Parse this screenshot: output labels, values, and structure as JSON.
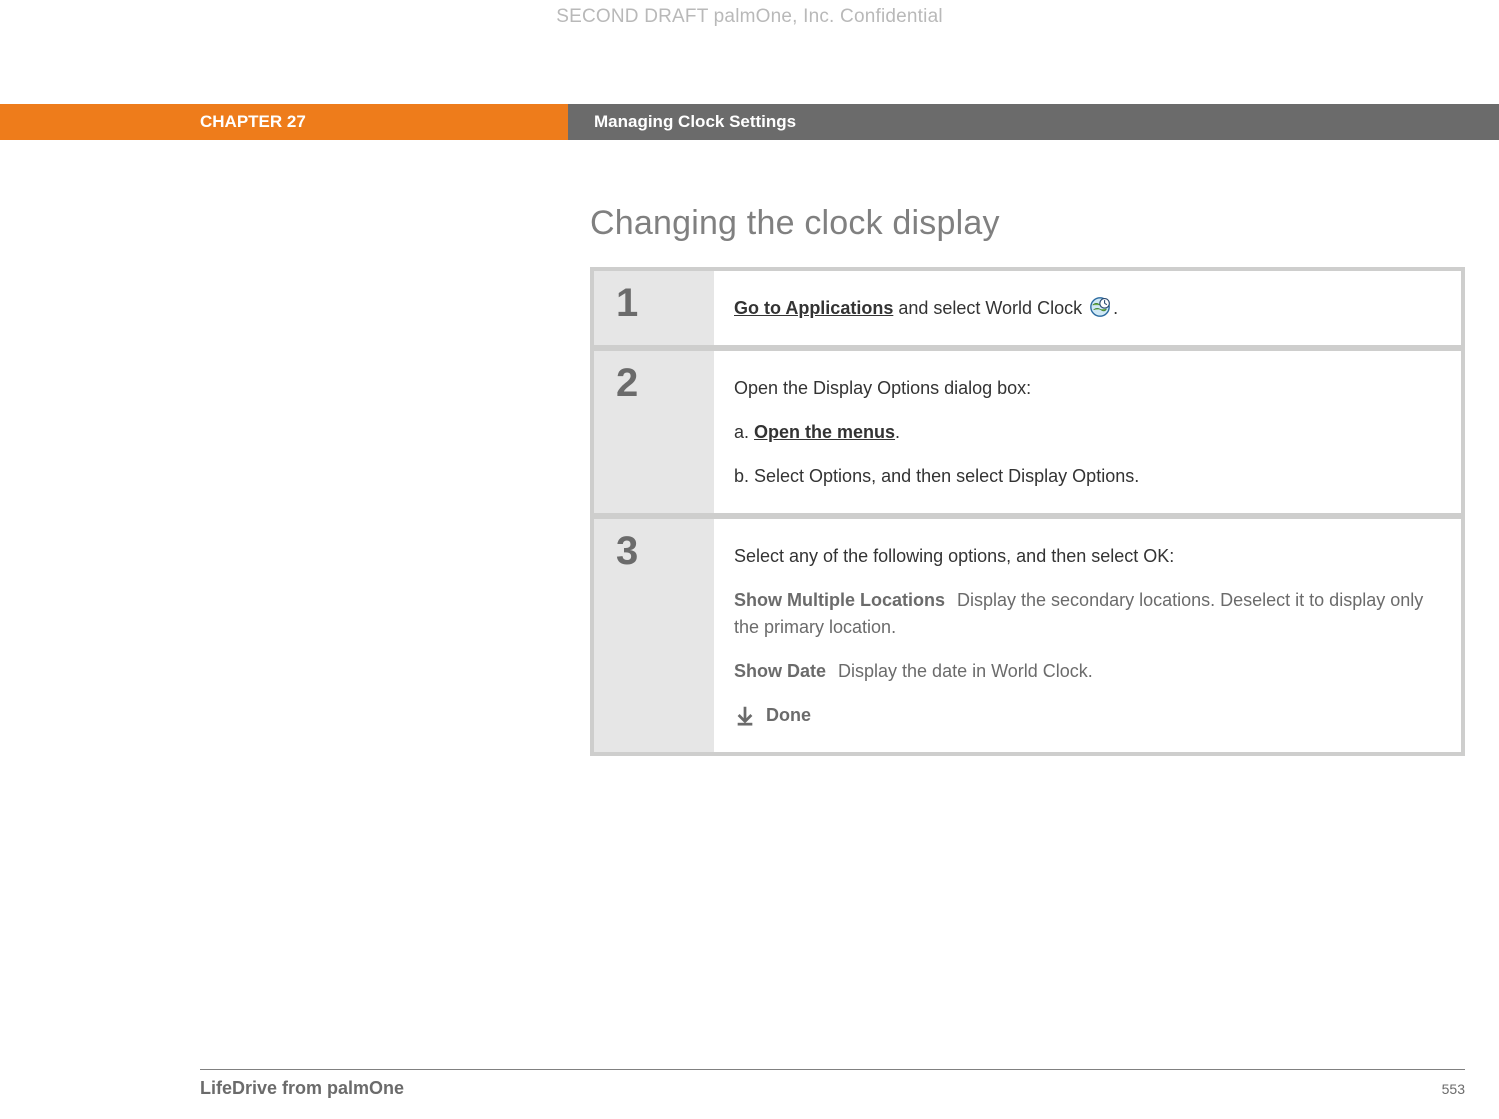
{
  "watermark": "SECOND DRAFT palmOne, Inc.  Confidential",
  "banner": {
    "chapter": "CHAPTER 27",
    "title": "Managing Clock Settings"
  },
  "section_title": "Changing the clock display",
  "steps": {
    "s1": {
      "num": "1",
      "link": "Go to Applications",
      "after_link": " and select World Clock ",
      "period": "."
    },
    "s2": {
      "num": "2",
      "intro": "Open the Display Options dialog box:",
      "a_prefix": "a.  ",
      "a_link": "Open the menus",
      "a_suffix": ".",
      "b": "b.  Select Options, and then select Display Options."
    },
    "s3": {
      "num": "3",
      "intro": "Select any of the following options, and then select OK:",
      "opt1_label": "Show Multiple Locations",
      "opt1_desc": "Display the secondary locations. Deselect it to display only the primary location.",
      "opt2_label": "Show Date",
      "opt2_desc": "Display the date in World Clock.",
      "done": "Done"
    }
  },
  "footer": {
    "product": "LifeDrive from palmOne",
    "page": "553"
  }
}
